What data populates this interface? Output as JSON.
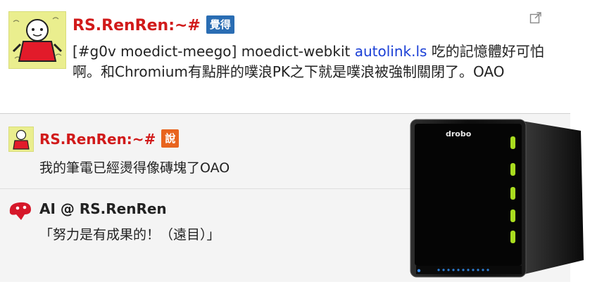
{
  "main_post": {
    "author": "RS.RenRen:~#",
    "verb": "覺得",
    "text_prefix": "[#g0v moedict-meego] moedict-webkit ",
    "link_text": "autolink.ls",
    "text_suffix": " 吃的記憶體好可怕啊。和Chromium有點胖的噗浪PK之下就是噗浪被強制關閉了。OAO"
  },
  "responses": [
    {
      "author": "RS.RenRen:~#",
      "verb": "說",
      "text": "我的筆電已經燙得像磚塊了OAO"
    },
    {
      "author": "AI @ RS.RenRen",
      "text": "「努力是有成果的！（遠目）」"
    }
  ],
  "product_image": {
    "brand_label": "drobo"
  },
  "colors": {
    "author": "#d11a1a",
    "verb_blue": "#2a6db3",
    "verb_orange": "#e8641e",
    "link": "#1a3fd6"
  },
  "icons": [
    "share-icon",
    "drobo-device-image"
  ]
}
